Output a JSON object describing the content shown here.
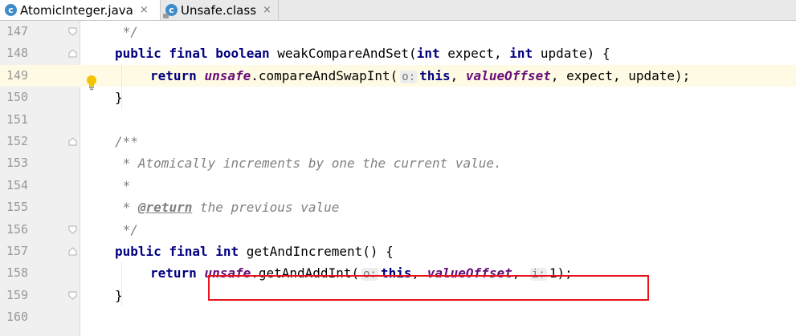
{
  "tabs": [
    {
      "label": "AtomicInteger.java",
      "active": true,
      "icon": "class-c-icon"
    },
    {
      "label": "Unsafe.class",
      "active": false,
      "icon": "class-c-locked-icon"
    }
  ],
  "close_glyph": "×",
  "lines": [
    {
      "num": "147",
      "text": " */"
    },
    {
      "num": "148",
      "text": "public final boolean weakCompareAndSet(int expect, int update) {"
    },
    {
      "num": "149",
      "text": "return unsafe.compareAndSwapInt( o: this, valueOffset, expect, update);"
    },
    {
      "num": "150",
      "text": "}"
    },
    {
      "num": "151",
      "text": ""
    },
    {
      "num": "152",
      "text": "/**"
    },
    {
      "num": "153",
      "text": " * Atomically increments by one the current value."
    },
    {
      "num": "154",
      "text": " *"
    },
    {
      "num": "155",
      "text": " * @return the previous value"
    },
    {
      "num": "156",
      "text": " */"
    },
    {
      "num": "157",
      "text": "public final int getAndIncrement() {"
    },
    {
      "num": "158",
      "text": "return unsafe.getAndAddInt( o: this, valueOffset,  i: 1);"
    },
    {
      "num": "159",
      "text": "}"
    },
    {
      "num": "160",
      "text": ""
    }
  ],
  "colors": {
    "keyword": "#000080",
    "field": "#660e7a",
    "comment": "#808080",
    "highlight_box": "#e8141c",
    "current_line": "#fffae3"
  }
}
